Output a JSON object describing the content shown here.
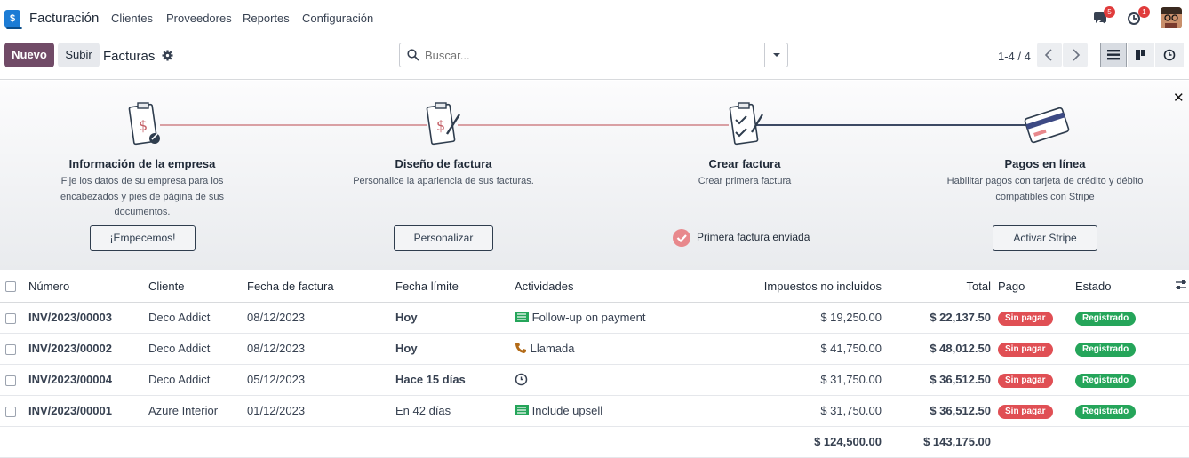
{
  "app": {
    "name": "Facturación"
  },
  "menu": [
    "Clientes",
    "Proveedores",
    "Reportes",
    "Configuración"
  ],
  "topbar": {
    "messages_badge": "5",
    "activities_badge": "1"
  },
  "controls": {
    "new_label": "Nuevo",
    "upload_label": "Subir",
    "breadcrumb": "Facturas",
    "search_placeholder": "Buscar...",
    "pager": "1-4 / 4"
  },
  "onboarding": {
    "steps": [
      {
        "title": "Información de la empresa",
        "desc": "Fije los datos de su empresa para los encabezados y pies de página de sus documentos.",
        "button": "¡Empecemos!"
      },
      {
        "title": "Diseño de factura",
        "desc": "Personalice la apariencia de sus facturas.",
        "button": "Personalizar"
      },
      {
        "title": "Crear factura",
        "desc": "Crear primera factura",
        "done": "Primera factura enviada"
      },
      {
        "title": "Pagos en línea",
        "desc": "Habilitar pagos con tarjeta de crédito y débito compatibles con Stripe",
        "button": "Activar Stripe"
      }
    ]
  },
  "table": {
    "columns": [
      "Número",
      "Cliente",
      "Fecha de factura",
      "Fecha límite",
      "Actividades",
      "Impuestos no incluidos",
      "Total",
      "Pago",
      "Estado"
    ],
    "rows": [
      {
        "number": "INV/2023/00003",
        "client": "Deco Addict",
        "date": "08/12/2023",
        "due": "Hoy",
        "due_style": "warn",
        "activity": "Follow-up on payment",
        "activity_icon": "email-icon",
        "untaxed": "$ 19,250.00",
        "total": "$ 22,137.50",
        "payment": "Sin pagar",
        "state": "Registrado"
      },
      {
        "number": "INV/2023/00002",
        "client": "Deco Addict",
        "date": "08/12/2023",
        "due": "Hoy",
        "due_style": "warn",
        "activity": "Llamada",
        "activity_icon": "phone-icon",
        "untaxed": "$ 41,750.00",
        "total": "$ 48,012.50",
        "payment": "Sin pagar",
        "state": "Registrado"
      },
      {
        "number": "INV/2023/00004",
        "client": "Deco Addict",
        "date": "05/12/2023",
        "due": "Hace 15 días",
        "due_style": "late",
        "activity": "",
        "activity_icon": "clock-icon",
        "untaxed": "$ 31,750.00",
        "total": "$ 36,512.50",
        "payment": "Sin pagar",
        "state": "Registrado"
      },
      {
        "number": "INV/2023/00001",
        "client": "Azure Interior",
        "date": "01/12/2023",
        "due": "En 42 días",
        "due_style": "normal",
        "activity": "Include upsell",
        "activity_icon": "email-icon",
        "untaxed": "$ 31,750.00",
        "total": "$ 36,512.50",
        "payment": "Sin pagar",
        "state": "Registrado"
      }
    ],
    "totals": {
      "untaxed": "$ 124,500.00",
      "total": "$ 143,175.00"
    }
  },
  "colors": {
    "brand": "#714b67",
    "unpaid": "#e04f54",
    "posted": "#25a55a"
  }
}
